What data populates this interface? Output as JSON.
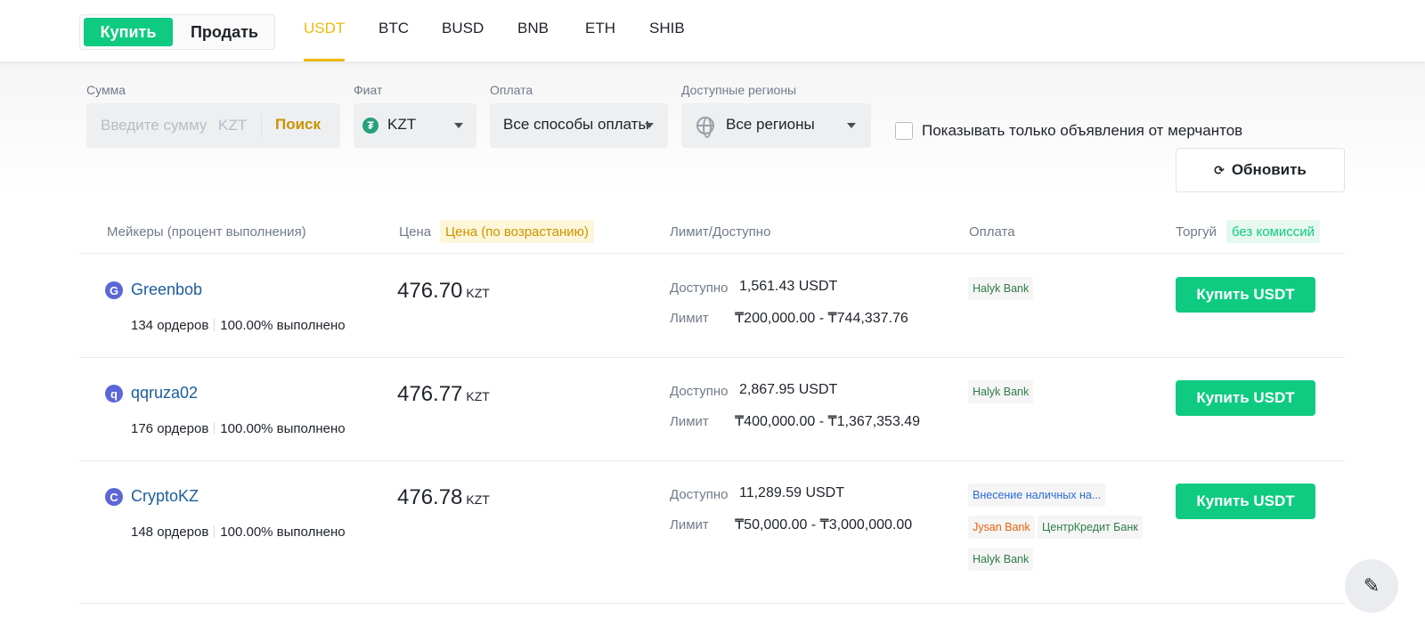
{
  "trade_toggle": {
    "buy": "Купить",
    "sell": "Продать"
  },
  "asset_tabs": [
    "USDT",
    "BTC",
    "BUSD",
    "BNB",
    "ETH",
    "SHIB"
  ],
  "active_asset": "USDT",
  "filters": {
    "amount_label": "Сумма",
    "amount_placeholder": "Введите сумму",
    "amount_currency": "KZT",
    "amount_search": "Поиск",
    "fiat_label": "Фиат",
    "fiat_value": "KZT",
    "payment_label": "Оплата",
    "payment_value": "Все способы оплаты",
    "regions_label": "Доступные регионы",
    "regions_value": "Все регионы",
    "merchant_only": "Показывать только объявления от мерчантов",
    "refresh": "Обновить"
  },
  "table_header": {
    "makers": "Мейкеры (процент выполнения)",
    "price": "Цена",
    "price_sort": "Цена (по возрастанию)",
    "limit": "Лимит/Доступно",
    "payment": "Оплата",
    "trade": "Торгуй",
    "trade_tag": "без комиссий"
  },
  "labels": {
    "available": "Доступно",
    "limit": "Лимит"
  },
  "rows": [
    {
      "initial": "G",
      "name": "Greenbob",
      "orders": "134 ордеров",
      "completion": "100.00% выполнено",
      "price": "476.70",
      "currency": "KZT",
      "available": "1,561.43 USDT",
      "limit": "₸200,000.00 - ₸744,337.76",
      "payments": [
        "Halyk Bank"
      ],
      "button": "Купить USDT"
    },
    {
      "initial": "q",
      "name": "qqruza02",
      "orders": "176 ордеров",
      "completion": "100.00% выполнено",
      "price": "476.77",
      "currency": "KZT",
      "available": "2,867.95 USDT",
      "limit": "₸400,000.00 - ₸1,367,353.49",
      "payments": [
        "Halyk Bank"
      ],
      "button": "Купить USDT"
    },
    {
      "initial": "C",
      "name": "CryptoKZ",
      "orders": "148 ордеров",
      "completion": "100.00% выполнено",
      "price": "476.78",
      "currency": "KZT",
      "available": "11,289.59 USDT",
      "limit": "₸50,000.00 - ₸3,000,000.00",
      "payments": [
        "Внесение наличных на...",
        "Jysan Bank",
        "ЦентрКредит Банк",
        "Halyk Bank"
      ],
      "button": "Купить USDT"
    }
  ],
  "icons": {
    "fab": "edit-icon",
    "refresh": "refresh-icon",
    "tether": "tether-icon",
    "globe": "globe-icon"
  }
}
